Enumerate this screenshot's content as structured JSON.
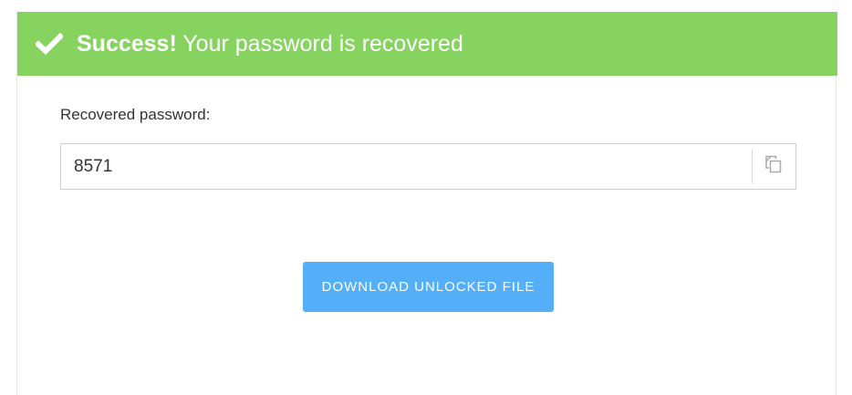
{
  "banner": {
    "status_icon": "check-icon",
    "strong": "Success!",
    "message": " Your password is recovered",
    "color": "#86d45f"
  },
  "result": {
    "label": "Recovered password:",
    "password": "8571",
    "copy_icon": "copy-icon"
  },
  "actions": {
    "download_label": "DOWNLOAD UNLOCKED FILE",
    "download_color": "#55aef8"
  }
}
